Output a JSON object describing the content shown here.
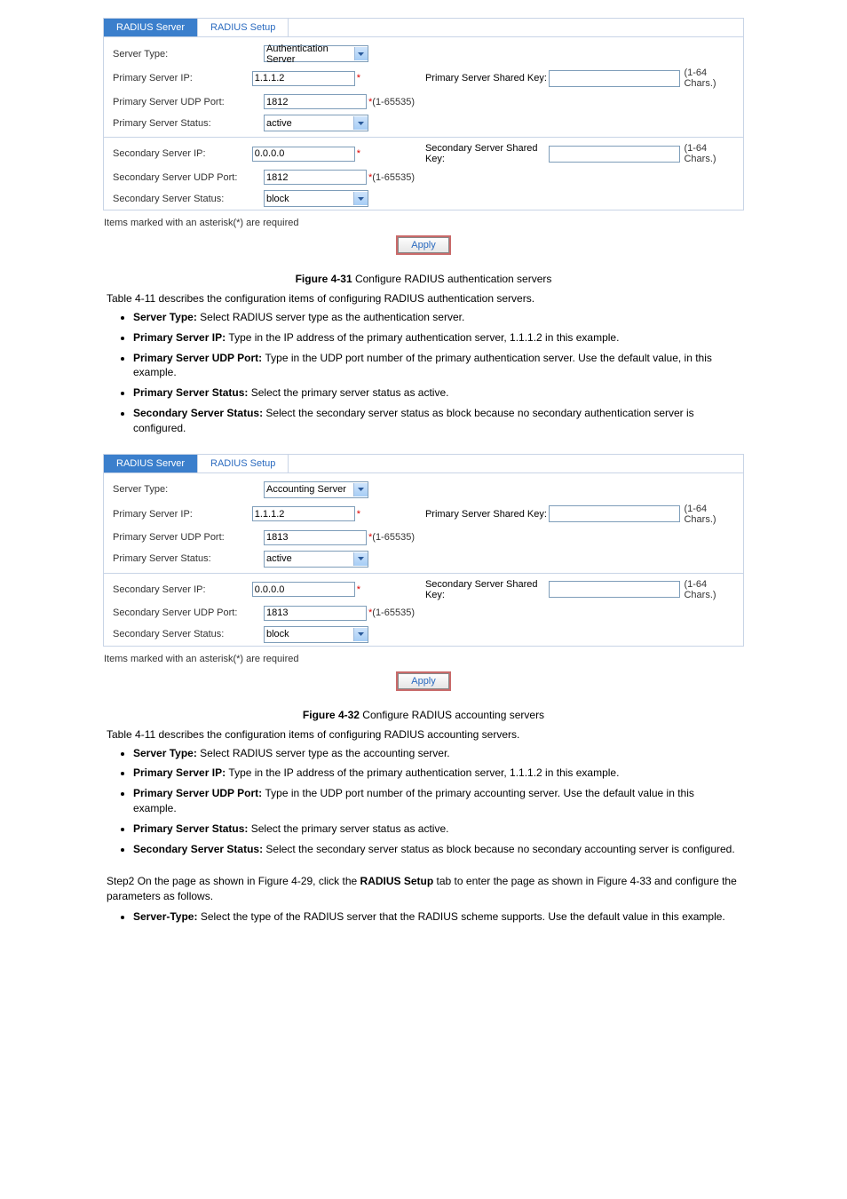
{
  "fig1": {
    "tabs": {
      "server": "RADIUS Server",
      "setup": "RADIUS Setup"
    },
    "labels": {
      "serverType": "Server Type:",
      "pIP": "Primary Server IP:",
      "pPort": "Primary Server UDP Port:",
      "pStatus": "Primary Server Status:",
      "sIP": "Secondary Server IP:",
      "sPort": "Secondary Server UDP Port:",
      "sStatus": "Secondary Server Status:",
      "pKey": "Primary Server Shared Key:",
      "sKey": "Secondary Server Shared Key:"
    },
    "values": {
      "serverType": "Authentication Server",
      "pIP": "1.1.1.2",
      "pPort": "1812",
      "pStatus": "active",
      "sIP": "0.0.0.0",
      "sPort": "1812",
      "sStatus": "block"
    },
    "hints": {
      "port": "*(1-65535)",
      "chars": "(1-64 Chars.)",
      "star": "*"
    },
    "note": "Items marked with an asterisk(*) are required",
    "apply": "Apply"
  },
  "caption1": {
    "pre": "Figure ",
    "num": "4-31",
    "post": " Configure RADIUS authentication servers "
  },
  "desc1": {
    "pre": "",
    "link": "Table 4-11",
    "post": " describes the configuration items of configuring RADIUS authentication servers."
  },
  "bullets1": [
    {
      "t": "Server Type: ",
      "d": "Select RADIUS server type as the authentication server."
    },
    {
      "t": "Primary Server IP: ",
      "d": "Type in the IP address of the primary authentication server, 1.1.1.2 in this example."
    },
    {
      "t": "Primary Server UDP Port: ",
      "d": "Type in the UDP port number of the primary authentication server. Use the default value, in this example."
    },
    {
      "t": "Primary Server Status: ",
      "d": "Select the primary server status as active."
    },
    {
      "t": "Secondary Server Status: ",
      "d": "Select the secondary server status as block because no secondary authentication server is configured."
    }
  ],
  "fig2": {
    "values": {
      "serverType": "Accounting Server",
      "pIP": "1.1.1.2",
      "pPort": "1813",
      "pStatus": "active",
      "sIP": "0.0.0.0",
      "sPort": "1813",
      "sStatus": "block"
    }
  },
  "caption2": {
    "pre": "Figure ",
    "num": "4-32",
    "post": " Configure RADIUS accounting servers "
  },
  "desc2": {
    "pre": "",
    "link": "Table 4-11",
    "post": " describes the configuration items of configuring RADIUS accounting servers."
  },
  "bullets2": [
    {
      "t": "Server Type: ",
      "d": "Select RADIUS server type as the accounting server."
    },
    {
      "t": "Primary Server IP: ",
      "d": "Type in the IP address of the primary authentication server, 1.1.1.2 in this example."
    },
    {
      "t": "Primary Server UDP Port: ",
      "d": "Type in the UDP port number of the primary accounting server. Use the default value in this example."
    },
    {
      "t": "Primary Server Status: ",
      "d": "Select the primary server status as active."
    },
    {
      "t": "Secondary Server Status: ",
      "d": "Select the secondary server status as block because no secondary accounting server is configured."
    }
  ],
  "step2": {
    "pre": "Step2   On the page as shown in ",
    "link": "Figure 4-29",
    "post": ", click the ",
    "tab": "RADIUS Setup",
    "post2": " tab to enter the page as shown in ",
    "link2": "Figure 4-33",
    "tail": " and configure the parameters as follows."
  },
  "bullets3": [
    {
      "t": "Server-Type: ",
      "d": "Select the type of the RADIUS server that the RADIUS scheme supports. Use the default value in this example."
    }
  ]
}
